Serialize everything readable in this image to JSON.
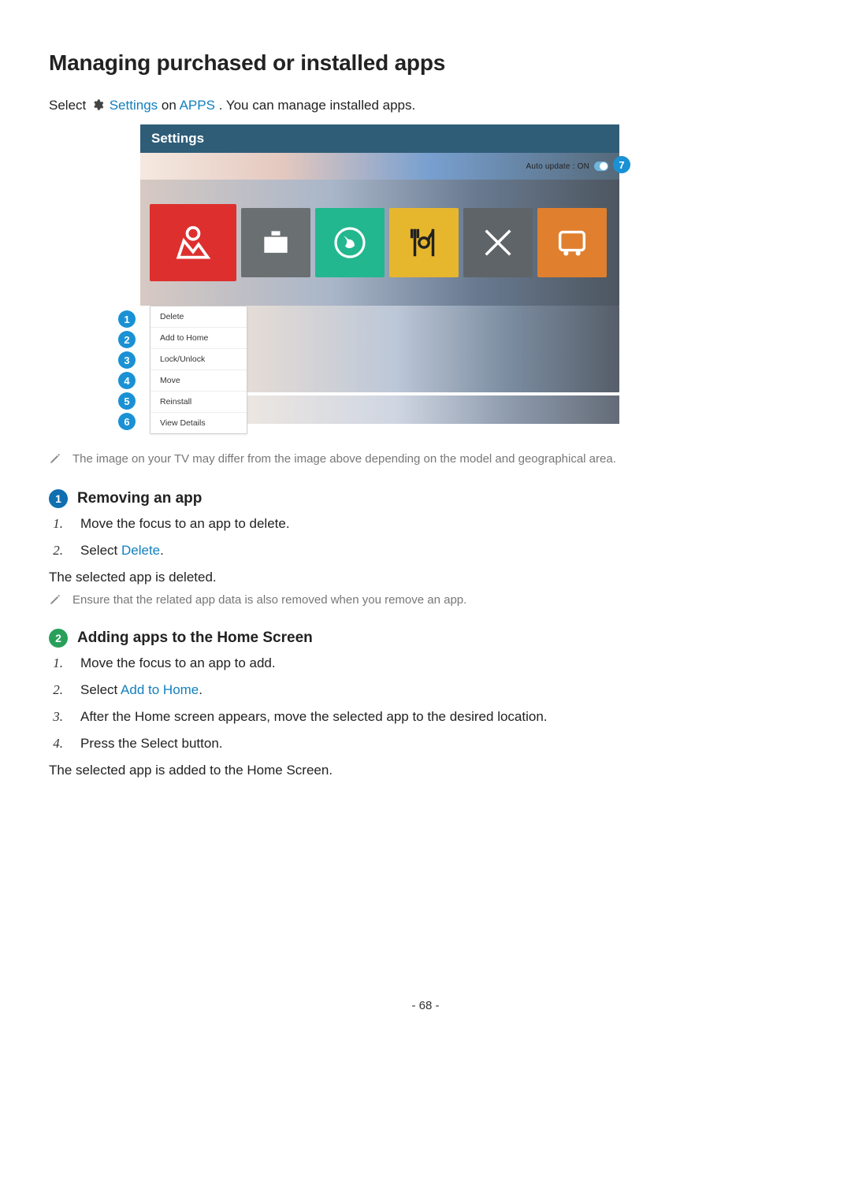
{
  "page": {
    "title": "Managing purchased or installed apps",
    "intro_prefix": "Select ",
    "intro_settings": "Settings",
    "intro_on": " on ",
    "intro_apps": "APPS",
    "intro_suffix": ". You can manage installed apps.",
    "page_number": "- 68 -"
  },
  "tv": {
    "header_title": "Settings",
    "auto_update_label": "Auto update : ON",
    "menu": [
      "Delete",
      "Add to Home",
      "Lock/Unlock",
      "Move",
      "Reinstall",
      "View Details"
    ],
    "badges_left": [
      "1",
      "2",
      "3",
      "4",
      "5",
      "6"
    ],
    "badge_right": "7"
  },
  "notes": {
    "image_differ": "The image on your TV may differ from the image above depending on the model and geographical area.",
    "ensure_app_data": "Ensure that the related app data is also removed when you remove an app."
  },
  "section1": {
    "badge": "1",
    "title": "Removing an app",
    "steps": {
      "s1_num": "1.",
      "s1_text": "Move the focus to an app to delete.",
      "s2_num": "2.",
      "s2_prefix": "Select ",
      "s2_link": "Delete",
      "s2_suffix": "."
    },
    "result": "The selected app is deleted."
  },
  "section2": {
    "badge": "2",
    "title": "Adding apps to the Home Screen",
    "steps": {
      "s1_num": "1.",
      "s1_text": "Move the focus to an app to add.",
      "s2_num": "2.",
      "s2_prefix": "Select ",
      "s2_link": "Add to Home",
      "s2_suffix": ".",
      "s3_num": "3.",
      "s3_text": "After the Home screen appears, move the selected app to the desired location.",
      "s4_num": "4.",
      "s4_text": "Press the Select button."
    },
    "result": "The selected app is added to the Home Screen."
  }
}
